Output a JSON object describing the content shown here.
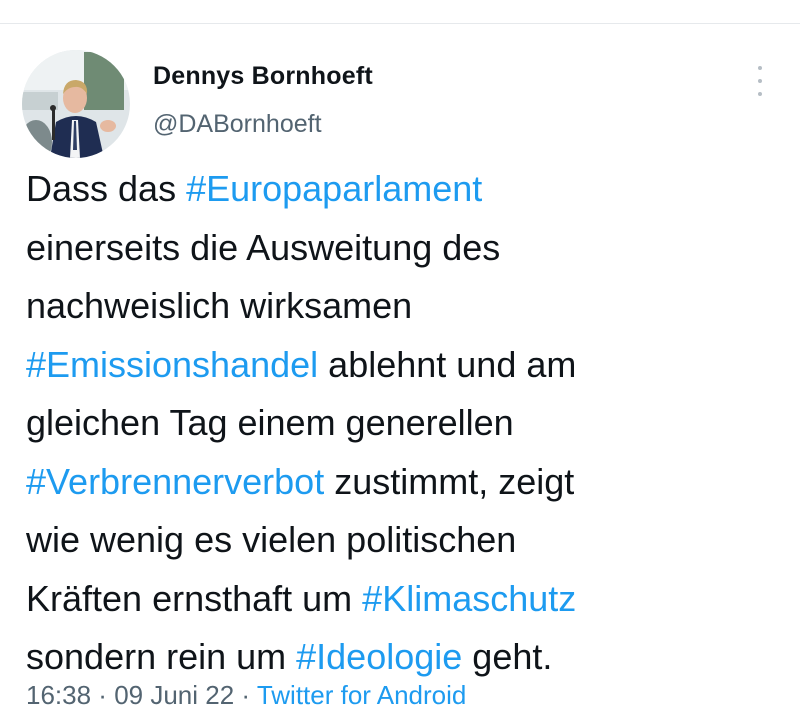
{
  "author": {
    "name": "Dennys Bornhoeft",
    "handle": "@DABornhoeft"
  },
  "colors": {
    "text": "#0f1419",
    "secondary": "#536471",
    "link": "#1d9bf0"
  },
  "tweet": {
    "lines": [
      {
        "segments": [
          {
            "text": "Dass das ",
            "hashtag": false
          },
          {
            "text": "#Europaparlament",
            "hashtag": true
          }
        ]
      },
      {
        "segments": [
          {
            "text": "einerseits die Ausweitung des",
            "hashtag": false
          }
        ]
      },
      {
        "segments": [
          {
            "text": "nachweislich wirksamen",
            "hashtag": false
          }
        ]
      },
      {
        "segments": [
          {
            "text": "#Emissionshandel",
            "hashtag": true
          },
          {
            "text": " ablehnt und am",
            "hashtag": false
          }
        ]
      },
      {
        "segments": [
          {
            "text": "gleichen Tag einem generellen",
            "hashtag": false
          }
        ]
      },
      {
        "segments": [
          {
            "text": "#Verbrennerverbot",
            "hashtag": true
          },
          {
            "text": " zustimmt, zeigt",
            "hashtag": false
          }
        ]
      },
      {
        "segments": [
          {
            "text": "wie wenig es vielen politischen",
            "hashtag": false
          }
        ]
      },
      {
        "segments": [
          {
            "text": "Kräften ernsthaft um ",
            "hashtag": false
          },
          {
            "text": "#Klimaschutz",
            "hashtag": true
          }
        ]
      },
      {
        "segments": [
          {
            "text": "sondern rein um ",
            "hashtag": false
          },
          {
            "text": "#Ideologie",
            "hashtag": true
          },
          {
            "text": " geht.",
            "hashtag": false
          }
        ]
      }
    ]
  },
  "meta": {
    "time": "16:38",
    "separator1": " · ",
    "date": "09 Juni 22",
    "separator2": " · ",
    "source": "Twitter for Android"
  },
  "icons": {
    "more": "more-vertical-icon",
    "avatar": "profile-photo"
  }
}
